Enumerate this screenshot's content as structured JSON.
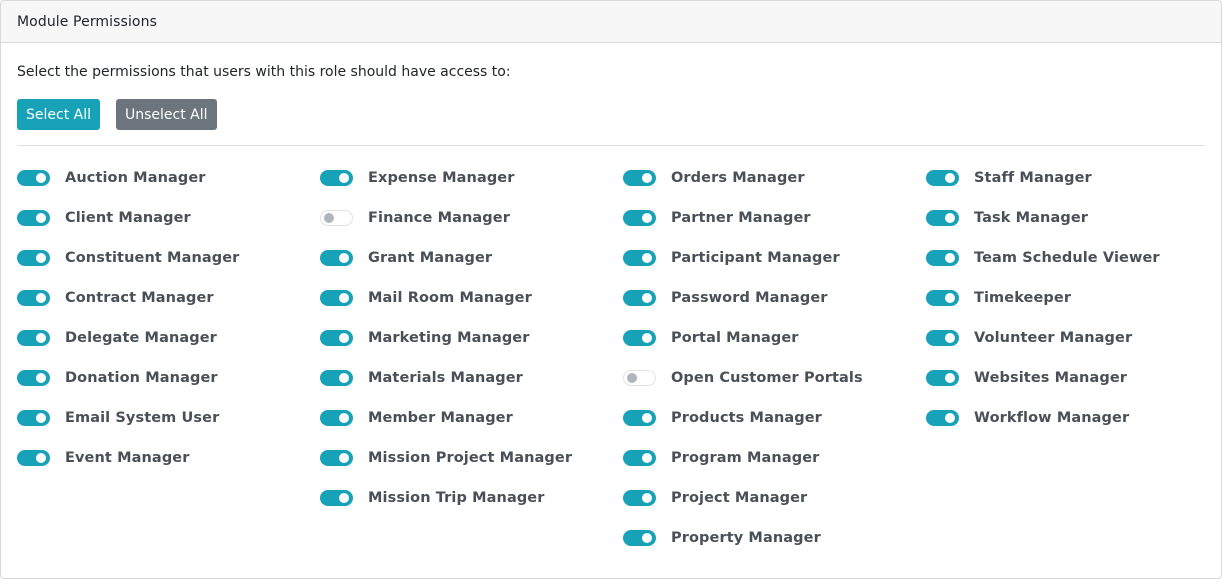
{
  "header": {
    "title": "Module Permissions"
  },
  "instructions": "Select the permissions that users with this role should have access to:",
  "buttons": {
    "select_all": "Select All",
    "unselect_all": "Unselect All"
  },
  "colors": {
    "accent": "#17a2b8",
    "secondary": "#6c757d",
    "toggle_off_knob": "#adb5bd"
  },
  "columns": [
    [
      {
        "label": "Auction Manager",
        "enabled": true
      },
      {
        "label": "Client Manager",
        "enabled": true
      },
      {
        "label": "Constituent Manager",
        "enabled": true
      },
      {
        "label": "Contract Manager",
        "enabled": true
      },
      {
        "label": "Delegate Manager",
        "enabled": true
      },
      {
        "label": "Donation Manager",
        "enabled": true
      },
      {
        "label": "Email System User",
        "enabled": true
      },
      {
        "label": "Event Manager",
        "enabled": true
      }
    ],
    [
      {
        "label": "Expense Manager",
        "enabled": true
      },
      {
        "label": "Finance Manager",
        "enabled": false
      },
      {
        "label": "Grant Manager",
        "enabled": true
      },
      {
        "label": "Mail Room Manager",
        "enabled": true
      },
      {
        "label": "Marketing Manager",
        "enabled": true
      },
      {
        "label": "Materials Manager",
        "enabled": true
      },
      {
        "label": "Member Manager",
        "enabled": true
      },
      {
        "label": "Mission Project Manager",
        "enabled": true
      },
      {
        "label": "Mission Trip Manager",
        "enabled": true
      }
    ],
    [
      {
        "label": "Orders Manager",
        "enabled": true
      },
      {
        "label": "Partner Manager",
        "enabled": true
      },
      {
        "label": "Participant Manager",
        "enabled": true
      },
      {
        "label": "Password Manager",
        "enabled": true
      },
      {
        "label": "Portal Manager",
        "enabled": true
      },
      {
        "label": "Open Customer Portals",
        "enabled": false
      },
      {
        "label": "Products Manager",
        "enabled": true
      },
      {
        "label": "Program Manager",
        "enabled": true
      },
      {
        "label": "Project Manager",
        "enabled": true
      },
      {
        "label": "Property Manager",
        "enabled": true
      }
    ],
    [
      {
        "label": "Staff Manager",
        "enabled": true
      },
      {
        "label": "Task Manager",
        "enabled": true
      },
      {
        "label": "Team Schedule Viewer",
        "enabled": true
      },
      {
        "label": "Timekeeper",
        "enabled": true
      },
      {
        "label": "Volunteer Manager",
        "enabled": true
      },
      {
        "label": "Websites Manager",
        "enabled": true
      },
      {
        "label": "Workflow Manager",
        "enabled": true
      }
    ]
  ]
}
